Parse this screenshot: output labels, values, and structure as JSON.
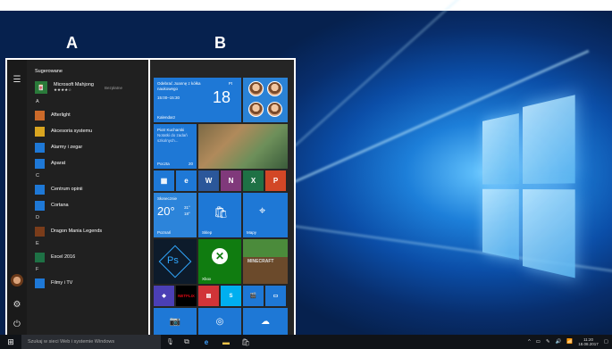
{
  "labels": {
    "a": "A",
    "b": "B"
  },
  "start_menu": {
    "section_suggested": "Sugerowane",
    "suggested_app": {
      "name": "Microsoft Mahjong",
      "stars": "★★★★☆",
      "tag": "Bezpłatne"
    },
    "groups": [
      {
        "letter": "A",
        "apps": [
          {
            "name": "Afterlight",
            "icon": "afterlight-icon",
            "color": "#cc6a2a"
          },
          {
            "name": "Akcesoria systemu",
            "icon": "folder-icon",
            "color": "#d9a520"
          },
          {
            "name": "Alarmy i zegar",
            "icon": "clock-icon",
            "color": "#1e78d6"
          },
          {
            "name": "Aparat",
            "icon": "camera-icon",
            "color": "#1e78d6"
          }
        ]
      },
      {
        "letter": "C",
        "apps": [
          {
            "name": "Centrum opinii",
            "icon": "feedback-icon",
            "color": "#1e78d6"
          },
          {
            "name": "Cortana",
            "icon": "cortana-icon",
            "color": "#1e78d6"
          }
        ]
      },
      {
        "letter": "D",
        "apps": [
          {
            "name": "Dragon Mania Legends",
            "icon": "dragon-icon",
            "color": "#7a3c1a"
          }
        ]
      },
      {
        "letter": "E",
        "apps": [
          {
            "name": "Excel 2016",
            "icon": "excel-icon",
            "color": "#1e7145"
          }
        ]
      },
      {
        "letter": "F",
        "apps": [
          {
            "name": "Filmy i TV",
            "icon": "film-icon",
            "color": "#1e78d6"
          }
        ]
      }
    ]
  },
  "tiles": {
    "calendar": {
      "event": "Odebrać Joannę z kółka naukowego",
      "time": "15:00–15:30",
      "day_name": "Pt",
      "day": "18",
      "label": "Kalendarz"
    },
    "mail": {
      "sender": "Piotr Kucharski",
      "preview": "Notatki do zadań szkolnych...",
      "label": "Poczta",
      "count": "20"
    },
    "weather": {
      "condition": "Słonecznie",
      "temp": "20°",
      "high": "31°",
      "low": "18°",
      "city": "Poznań"
    },
    "store": {
      "label": "Sklep"
    },
    "maps": {
      "label": "Mapy"
    },
    "ps": {
      "text": "Ps"
    },
    "xbox": {
      "label": "Xbox"
    },
    "minecraft": {
      "text": "MINECRAFT"
    },
    "netflix": {
      "text": "NETFLIX"
    }
  },
  "taskbar": {
    "search_placeholder": "Szukaj w sieci Web i systemie Windows",
    "time": "11:20",
    "date": "18.08.2017"
  }
}
